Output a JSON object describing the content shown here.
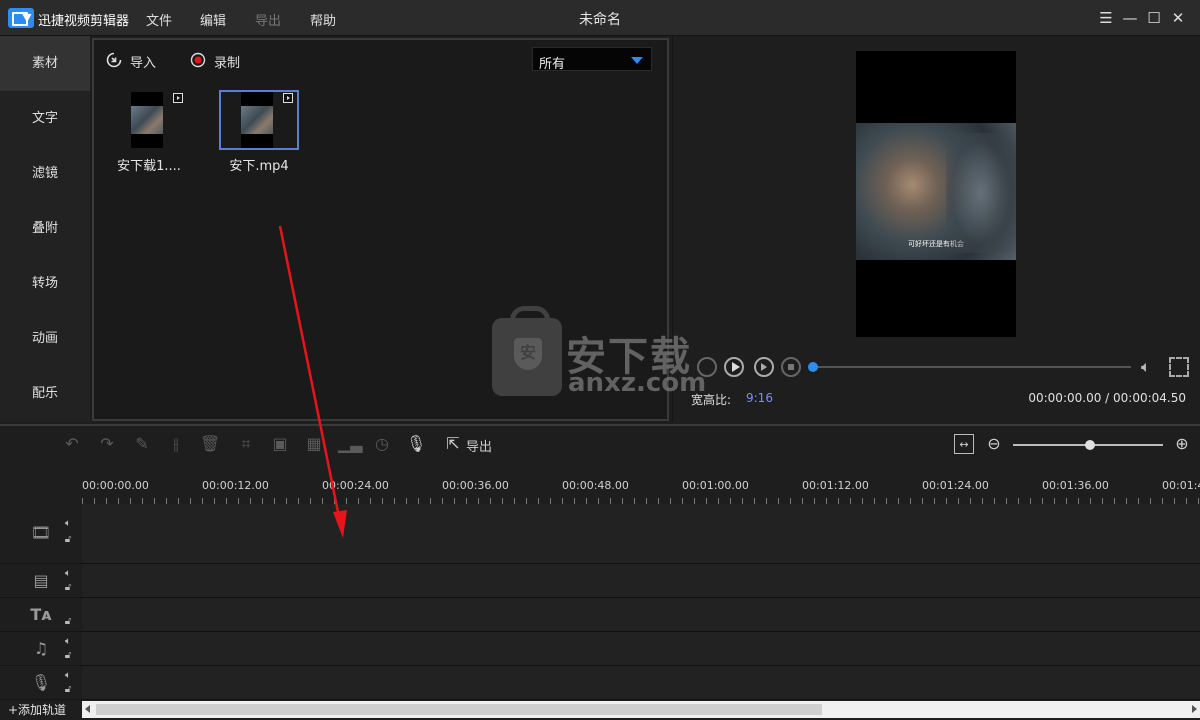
{
  "app": {
    "name": "迅捷视频剪辑器",
    "window_title": "未命名"
  },
  "menu": [
    {
      "label": "文件",
      "enabled": true
    },
    {
      "label": "编辑",
      "enabled": true
    },
    {
      "label": "导出",
      "enabled": false
    },
    {
      "label": "帮助",
      "enabled": true
    }
  ],
  "window_controls": [
    "menu-icon",
    "minimize-icon",
    "maximize-icon",
    "close-icon"
  ],
  "sidebar": {
    "items": [
      {
        "label": "素材",
        "active": true
      },
      {
        "label": "文字",
        "active": false
      },
      {
        "label": "滤镜",
        "active": false
      },
      {
        "label": "叠附",
        "active": false
      },
      {
        "label": "转场",
        "active": false
      },
      {
        "label": "动画",
        "active": false
      },
      {
        "label": "配乐",
        "active": false
      }
    ]
  },
  "library": {
    "import_label": "导入",
    "record_label": "录制",
    "filter_value": "所有",
    "items": [
      {
        "name": "安下载1....",
        "selected": false
      },
      {
        "name": "安下.mp4",
        "selected": true
      }
    ]
  },
  "preview": {
    "subtitle_text": "可好坏还是有机会",
    "aspect_label": "宽高比:",
    "aspect_value": "9:16",
    "time_current": "00:00:00.00",
    "time_total": "00:00:04.50",
    "time_readout": "00:00:00.00 / 00:00:04.50",
    "progress_fraction": 0.0
  },
  "watermark": {
    "title": "安下载",
    "domain": "anxz.com"
  },
  "toolbar": {
    "tools": [
      {
        "icon": "undo-icon",
        "enabled": false
      },
      {
        "icon": "redo-icon",
        "enabled": false
      },
      {
        "icon": "edit-icon",
        "enabled": false
      },
      {
        "icon": "split-icon",
        "enabled": false
      },
      {
        "icon": "delete-icon",
        "enabled": false
      },
      {
        "icon": "crop-icon",
        "enabled": false
      },
      {
        "icon": "freeze-frame-icon",
        "enabled": false
      },
      {
        "icon": "mosaic-icon",
        "enabled": false
      },
      {
        "icon": "audio-levels-icon",
        "enabled": false
      },
      {
        "icon": "duration-icon",
        "enabled": false
      },
      {
        "icon": "microphone-icon",
        "enabled": true
      },
      {
        "icon": "export-icon",
        "enabled": true
      }
    ],
    "export_label": "导出",
    "zoom_fraction": 0.51
  },
  "timeline": {
    "ruler_labels": [
      "00:00:00.00",
      "00:00:12.00",
      "00:00:24.00",
      "00:00:36.00",
      "00:00:48.00",
      "00:01:00.00",
      "00:01:12.00",
      "00:01:24.00",
      "00:01:36.00",
      "00:01:4"
    ],
    "tracks": [
      {
        "type": "video-main",
        "icon": "film-icon"
      },
      {
        "type": "video-overlay",
        "icon": "film-strip-icon"
      },
      {
        "type": "text",
        "icon": "text-icon"
      },
      {
        "type": "music",
        "icon": "music-icon"
      },
      {
        "type": "voice",
        "icon": "microphone-icon"
      }
    ],
    "add_track_label": "+添加轨道"
  },
  "colors": {
    "accent": "#2d8cf0",
    "aspect_value": "#7a8cff",
    "annotation_arrow": "#e8141b"
  }
}
